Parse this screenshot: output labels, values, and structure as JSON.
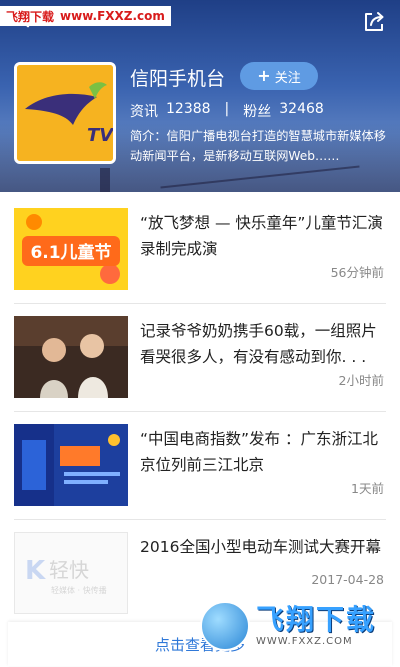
{
  "watermark": {
    "brand": "飞翔下载",
    "url": "www.FXXZ.com"
  },
  "header": {
    "channel_name": "信阳手机台",
    "follow_label": "关注",
    "stats": {
      "news_label": "资讯",
      "news_count": "12388",
      "divider": "|",
      "fans_label": "粉丝",
      "fans_count": "32468"
    },
    "intro": "简介：信阳广播电视台打造的智慧城市新媒体移动新闻平台，是新移动互联网Web……"
  },
  "news": [
    {
      "title": "“放飞梦想 — 快乐童年”儿童节汇演录制完成演",
      "time": "56分钟前",
      "thumb": "childrens-day-banner"
    },
    {
      "title": "记录爷爷奶奶携手60载，一组照片看哭很多人，有没有感动到你. . .",
      "time": "2小时前",
      "thumb": "elderly-couple-photo"
    },
    {
      "title": "“中国电商指数”发布 ：广东浙江北京位列前三江北京",
      "time": "1天前",
      "thumb": "ecommerce-report-cover"
    },
    {
      "title": "2016全国小型电动车测试大赛开幕",
      "time": "2017-04-28",
      "thumb": "qingkuai-logo-placeholder"
    }
  ],
  "thumb_texts": {
    "childrens_day": "6.1儿童节",
    "qingkuai_brand": "轻快",
    "qingkuai_slogan": "轻媒体 · 快传播"
  },
  "bottom_link": "点击查看更多",
  "corner_logo": {
    "name": "飞翔下载",
    "url": "WWW.FXXZ.COM"
  },
  "colors": {
    "accent": "#2f78d8",
    "follow_bg": "#5f9be3",
    "logo_bg": "#f6b320"
  }
}
